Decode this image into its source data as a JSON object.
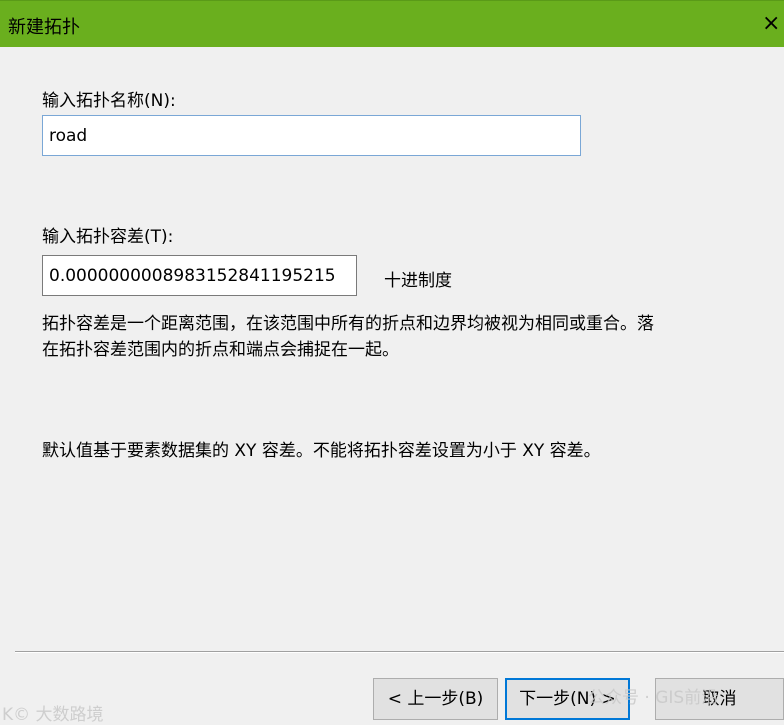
{
  "window": {
    "title": "新建拓扑",
    "close_glyph": "×"
  },
  "form": {
    "name_label": "输入拓扑名称(N):",
    "name_value": "road",
    "tolerance_label": "输入拓扑容差(T):",
    "tolerance_value": "0.0000000008983152841195215",
    "unit_label": "十进制度",
    "description_line1": "拓扑容差是一个距离范围，在该范围中所有的折点和边界均被视为相同或重合。落",
    "description_line2": "在拓扑容差范围内的折点和端点会捕捉在一起。",
    "default_note": "默认值基于要素数据集的 XY 容差。不能将拓扑容差设置为小于 XY 容差。"
  },
  "buttons": {
    "back_label": "< 上一步(B)",
    "next_label": "下一步(N) >",
    "cancel_label": "取消"
  },
  "watermarks": {
    "left": "K© 大数路境",
    "right": "公众号 · GIS前沿"
  },
  "colors": {
    "titlebar": "#6aaf1e",
    "background": "#f0f0f0",
    "focus_border": "#0078d7"
  }
}
